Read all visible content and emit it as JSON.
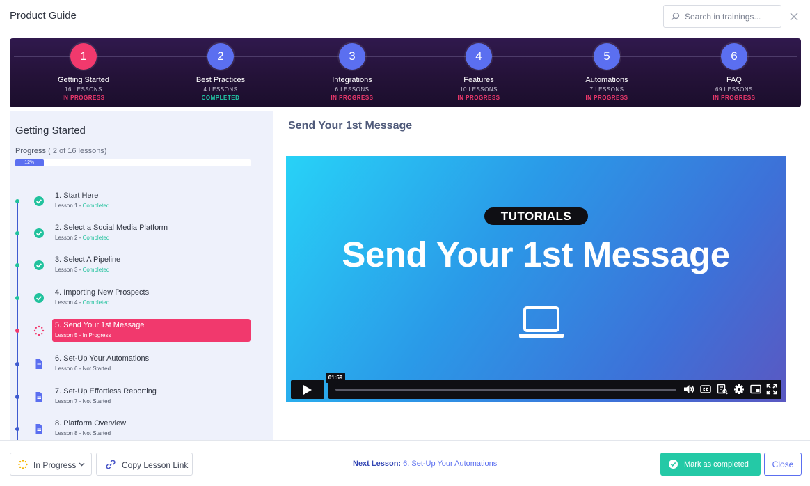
{
  "app": {
    "title": "Product Guide"
  },
  "search": {
    "placeholder": "Search in trainings..."
  },
  "colors": {
    "accent": "#5b6ff0",
    "active": "#f1396d",
    "success": "#24c9a6",
    "banner": "#241238",
    "sidebar_bg": "#eef1fb"
  },
  "steps": [
    {
      "number": "1",
      "title": "Getting Started",
      "lessons": "16 LESSONS",
      "status": "IN PROGRESS"
    },
    {
      "number": "2",
      "title": "Best Practices",
      "lessons": "4 LESSONS",
      "status": "COMPLETED"
    },
    {
      "number": "3",
      "title": "Integrations",
      "lessons": "6 LESSONS",
      "status": "IN PROGRESS"
    },
    {
      "number": "4",
      "title": "Features",
      "lessons": "10 LESSONS",
      "status": "IN PROGRESS"
    },
    {
      "number": "5",
      "title": "Automations",
      "lessons": "7 LESSONS",
      "status": "IN PROGRESS"
    },
    {
      "number": "6",
      "title": "FAQ",
      "lessons": "69 LESSONS",
      "status": "IN PROGRESS"
    }
  ],
  "sidebar": {
    "section_title": "Getting Started",
    "progress_label": "Progress",
    "progress_detail": "( 2 of 16 lessons)",
    "progress_percent_label": "12%",
    "progress_fraction": 0.12,
    "lessons": [
      {
        "title": "1. Start Here",
        "lesson": "Lesson 1 - ",
        "status": "Completed",
        "icon": "check-circle-icon"
      },
      {
        "title": "2. Select a Social Media Platform",
        "lesson": "Lesson 2 - ",
        "status": "Completed",
        "icon": "check-circle-icon"
      },
      {
        "title": "3. Select A Pipeline",
        "lesson": "Lesson 3 - ",
        "status": "Completed",
        "icon": "check-circle-icon"
      },
      {
        "title": "4. Importing New Prospects",
        "lesson": "Lesson 4 - ",
        "status": "Completed",
        "icon": "check-circle-icon"
      },
      {
        "title": "5. Send Your 1st Message",
        "lesson": "Lesson 5 - ",
        "status": "In Progress",
        "icon": "spinner-icon"
      },
      {
        "title": "6. Set-Up Your Automations",
        "lesson": "Lesson 6 - ",
        "status": "Not Started",
        "icon": "document-icon"
      },
      {
        "title": "7. Set-Up Effortless Reporting",
        "lesson": "Lesson 7 - ",
        "status": "Not Started",
        "icon": "document-icon"
      },
      {
        "title": "8. Platform Overview",
        "lesson": "Lesson 8 - ",
        "status": "Not Started",
        "icon": "document-icon"
      }
    ]
  },
  "content": {
    "title": "Send Your 1st Message",
    "video": {
      "badge": "TUTORIALS",
      "headline": "Send Your 1st Message",
      "time_tooltip": "01:59"
    }
  },
  "footer": {
    "status_button": "In Progress",
    "copy_button": "Copy Lesson Link",
    "next_label": "Next Lesson:",
    "next_value": "6. Set-Up Your Automations",
    "complete_button": "Mark as completed",
    "close_button": "Close"
  }
}
